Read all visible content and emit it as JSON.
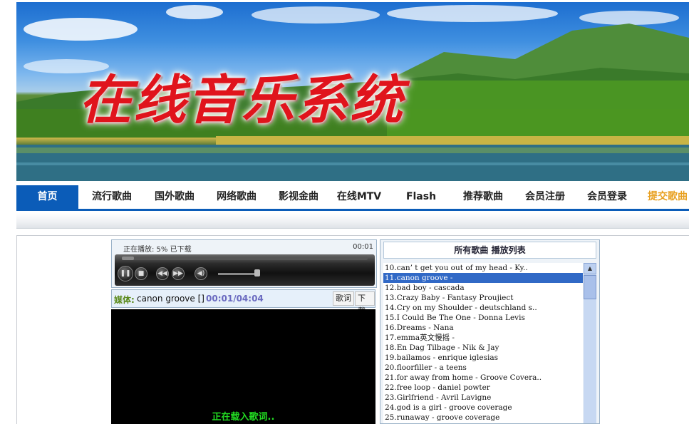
{
  "banner": {
    "logo_text": "在线音乐系统"
  },
  "nav": {
    "items": [
      {
        "label": "首页"
      },
      {
        "label": "流行歌曲"
      },
      {
        "label": "国外歌曲"
      },
      {
        "label": "网络歌曲"
      },
      {
        "label": "影视金曲"
      },
      {
        "label": "在线MTV"
      },
      {
        "label": "Flash"
      },
      {
        "label": "推荐歌曲"
      },
      {
        "label": "会员注册"
      },
      {
        "label": "会员登录"
      },
      {
        "label": "提交歌曲"
      }
    ]
  },
  "player": {
    "status": "正在播放: 5% 已下载",
    "time": "00:01",
    "progress_fraction": 0.05
  },
  "media": {
    "label": "媒体:",
    "title": "canon groove []",
    "time": "00:01/04:04",
    "lyrics_button": "歌词",
    "download_button": "下载"
  },
  "lyrics": {
    "loading": "正在载入歌词.."
  },
  "playlist": {
    "header": "所有歌曲 播放列表",
    "selected_index": 1,
    "items": [
      "10.can’ t get you out of my head - Ky..",
      "11.canon groove -",
      "12.bad boy - cascada",
      "13.Crazy Baby - Fantasy Proujiect",
      "14.Cry on my Shoulder - deutschland s..",
      "15.I Could Be The One - Donna Levis",
      "16.Dreams - Nana",
      "17.emma英文慢摇 -",
      "18.En Dag Tilbage - Nik & Jay",
      "19.bailamos - enrique iglesias",
      "20.floorfiller - a teens",
      "21.for away from home - Groove Covera..",
      "22.free loop - daniel powter",
      "23.Girlfriend - Avril Lavigne",
      "24.god is a girl - groove coverage",
      "25.runaway - groove coverage"
    ]
  }
}
